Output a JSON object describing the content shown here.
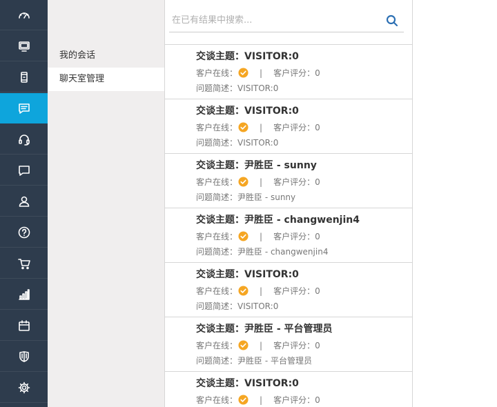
{
  "rail": {
    "items": [
      {
        "icon": "dashboard-icon",
        "active": false
      },
      {
        "icon": "monitor-icon",
        "active": false
      },
      {
        "icon": "mobile-icon",
        "active": false
      },
      {
        "icon": "chat-list-icon",
        "active": true
      },
      {
        "icon": "headset-icon",
        "active": false
      },
      {
        "icon": "message-bubble-icon",
        "active": false
      },
      {
        "icon": "user-icon",
        "active": false
      },
      {
        "icon": "help-icon",
        "active": false
      },
      {
        "icon": "cart-icon",
        "active": false
      },
      {
        "icon": "bar-chart-icon",
        "active": false
      },
      {
        "icon": "calendar-icon",
        "active": false
      },
      {
        "icon": "shield-icon",
        "active": false
      },
      {
        "icon": "gear-icon",
        "active": false
      }
    ],
    "colors": {
      "background": "#2e3c4d",
      "active": "#0ea5dc"
    }
  },
  "panel": {
    "items": [
      {
        "label": "我的会话",
        "active": false
      },
      {
        "label": "聊天室管理",
        "active": true
      }
    ]
  },
  "search": {
    "placeholder": "在已有结果中搜索...",
    "value": "",
    "icon": "search-icon"
  },
  "conversations": [
    {
      "title": "交谈主题：VISITOR:0",
      "online_label": "客户在线：",
      "online": true,
      "rating": "客户评分：0",
      "desc": "问题简述：VISITOR:0"
    },
    {
      "title": "交谈主题：VISITOR:0",
      "online_label": "客户在线：",
      "online": true,
      "rating": "客户评分：0",
      "desc": "问题简述：VISITOR:0"
    },
    {
      "title": "交谈主题：尹胜臣 - sunny",
      "online_label": "客户在线：",
      "online": true,
      "rating": "客户评分：0",
      "desc": "问题简述：尹胜臣 - sunny"
    },
    {
      "title": "交谈主题：尹胜臣 - changwenjin4",
      "online_label": "客户在线：",
      "online": true,
      "rating": "客户评分：0",
      "desc": "问题简述：尹胜臣 - changwenjin4"
    },
    {
      "title": "交谈主题：VISITOR:0",
      "online_label": "客户在线：",
      "online": true,
      "rating": "客户评分：0",
      "desc": "问题简述：VISITOR:0"
    },
    {
      "title": "交谈主题：尹胜臣 - 平台管理员",
      "online_label": "客户在线：",
      "online": true,
      "rating": "客户评分：0",
      "desc": "问题简述：尹胜臣 - 平台管理员"
    },
    {
      "title": "交谈主题：VISITOR:0",
      "online_label": "客户在线：",
      "online": true,
      "rating": "客户评分：0",
      "desc": ""
    }
  ],
  "separator": "|",
  "colors": {
    "online_check": "#f5a623",
    "search_icon": "#2b6fb3"
  }
}
